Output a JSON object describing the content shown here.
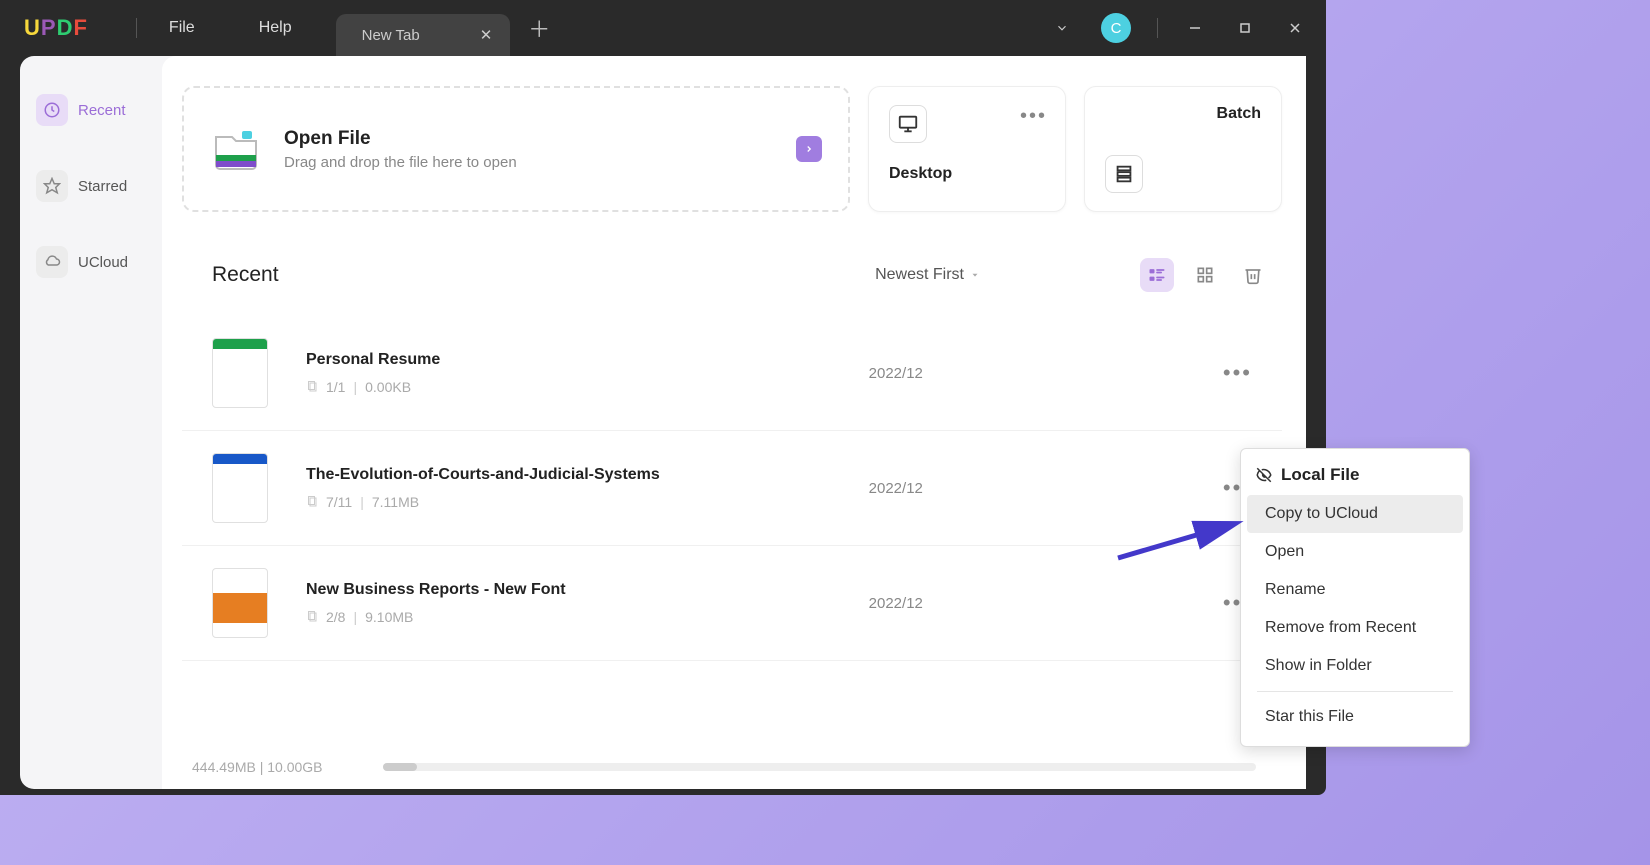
{
  "app": {
    "logo": {
      "u": "U",
      "p": "P",
      "d": "D",
      "f": "F"
    }
  },
  "menu": {
    "file": "File",
    "help": "Help"
  },
  "tab": {
    "title": "New Tab"
  },
  "avatar": {
    "initial": "C"
  },
  "sidebar": {
    "recent": "Recent",
    "starred": "Starred",
    "ucloud": "UCloud"
  },
  "open_file": {
    "title": "Open File",
    "subtitle": "Drag and drop the file here to open"
  },
  "cards": {
    "desktop": "Desktop",
    "batch": "Batch"
  },
  "list": {
    "title": "Recent",
    "sort": "Newest First"
  },
  "files": [
    {
      "name": "Personal Resume",
      "pages": "1/1",
      "size": "0.00KB",
      "date": "2022/12",
      "thumb_color": "#1ea04b"
    },
    {
      "name": "The-Evolution-of-Courts-and-Judicial-Systems",
      "pages": "7/11",
      "size": "7.11MB",
      "date": "2022/12",
      "thumb_color": "#1858c8"
    },
    {
      "name": "New Business Reports - New Font",
      "pages": "2/8",
      "size": "9.10MB",
      "date": "2022/12",
      "thumb_color": "#e67e22"
    }
  ],
  "storage": {
    "text": "444.49MB | 10.00GB"
  },
  "context_menu": {
    "header": "Local File",
    "items": [
      "Copy to UCloud",
      "Open",
      "Rename",
      "Remove from Recent",
      "Show in Folder"
    ],
    "star": "Star this File"
  }
}
